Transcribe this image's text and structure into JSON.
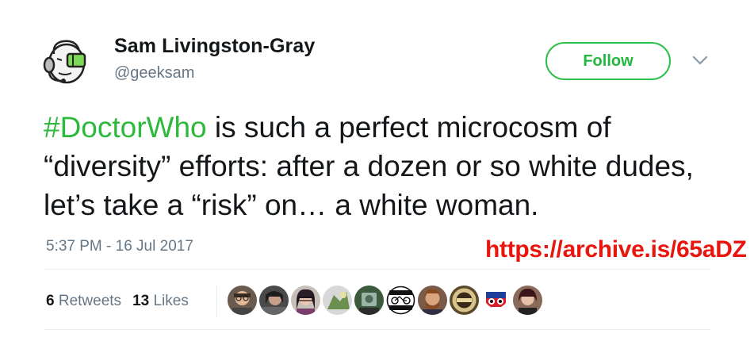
{
  "author": {
    "display_name": "Sam Livingston-Gray",
    "handle": "@geeksam",
    "avatar_icon": "robot-headset-avatar"
  },
  "follow_label": "Follow",
  "tweet": {
    "hashtag": "#DoctorWho",
    "text": " is such a perfect microcosm of “diversity” efforts: after a dozen or so white dudes, let’s take a “risk” on… a white woman."
  },
  "timestamp": "5:37 PM - 16 Jul 2017",
  "archive_link": "https://archive.is/65aDZ",
  "stats": {
    "retweets_count": "6",
    "retweets_label": "Retweets",
    "likes_count": "13",
    "likes_label": "Likes"
  },
  "colors": {
    "accent_green": "#2db93b",
    "archive_red": "#e8160e",
    "muted_text": "#657786"
  }
}
